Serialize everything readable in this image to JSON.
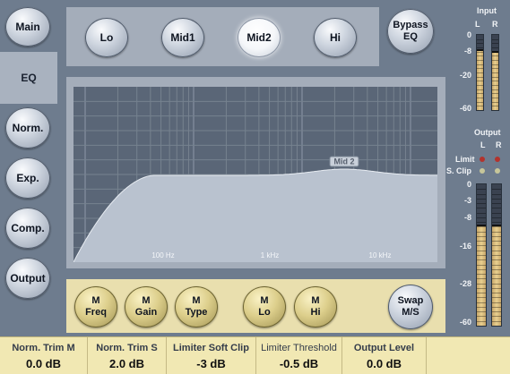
{
  "nav": {
    "items": [
      {
        "label": "Main"
      },
      {
        "label": "EQ"
      },
      {
        "label": "Norm."
      },
      {
        "label": "Exp."
      },
      {
        "label": "Comp."
      },
      {
        "label": "Output"
      }
    ]
  },
  "bands": [
    {
      "label": "Lo"
    },
    {
      "label": "Mid1"
    },
    {
      "label": "Mid2"
    },
    {
      "label": "Hi"
    }
  ],
  "bypass_label": "Bypass\nEQ",
  "graph": {
    "freq_labels": [
      "100 Hz",
      "1 kHz",
      "10 kHz"
    ],
    "marker_label": "Mid 2"
  },
  "controls": [
    {
      "label": "M\nFreq"
    },
    {
      "label": "M\nGain"
    },
    {
      "label": "M\nType"
    },
    {
      "label": "M\nLo"
    },
    {
      "label": "M\nHi"
    }
  ],
  "swap_label": "Swap\nM/S",
  "input_meter": {
    "title": "Input",
    "channels": [
      "L",
      "R"
    ],
    "scale": [
      "0",
      "-8",
      "-20",
      "-60"
    ],
    "level_fraction": [
      0.78,
      0.76
    ]
  },
  "output_meter": {
    "title": "Output",
    "channels": [
      "L",
      "R"
    ],
    "limit_label": "Limit",
    "sclip_label": "S. Clip",
    "scale": [
      "0",
      "-3",
      "-8",
      "-16",
      "-28",
      "-60"
    ],
    "level_fraction": [
      0.7,
      0.7
    ]
  },
  "status": [
    {
      "label": "Norm. Trim M",
      "value": "0.0 dB"
    },
    {
      "label": "Norm. Trim S",
      "value": "2.0 dB"
    },
    {
      "label": "Limiter Soft Clip",
      "value": "-3 dB"
    },
    {
      "label": "Limiter Threshold",
      "value": "-0.5 dB"
    },
    {
      "label": "Output Level",
      "value": "0.0 dB"
    }
  ]
}
